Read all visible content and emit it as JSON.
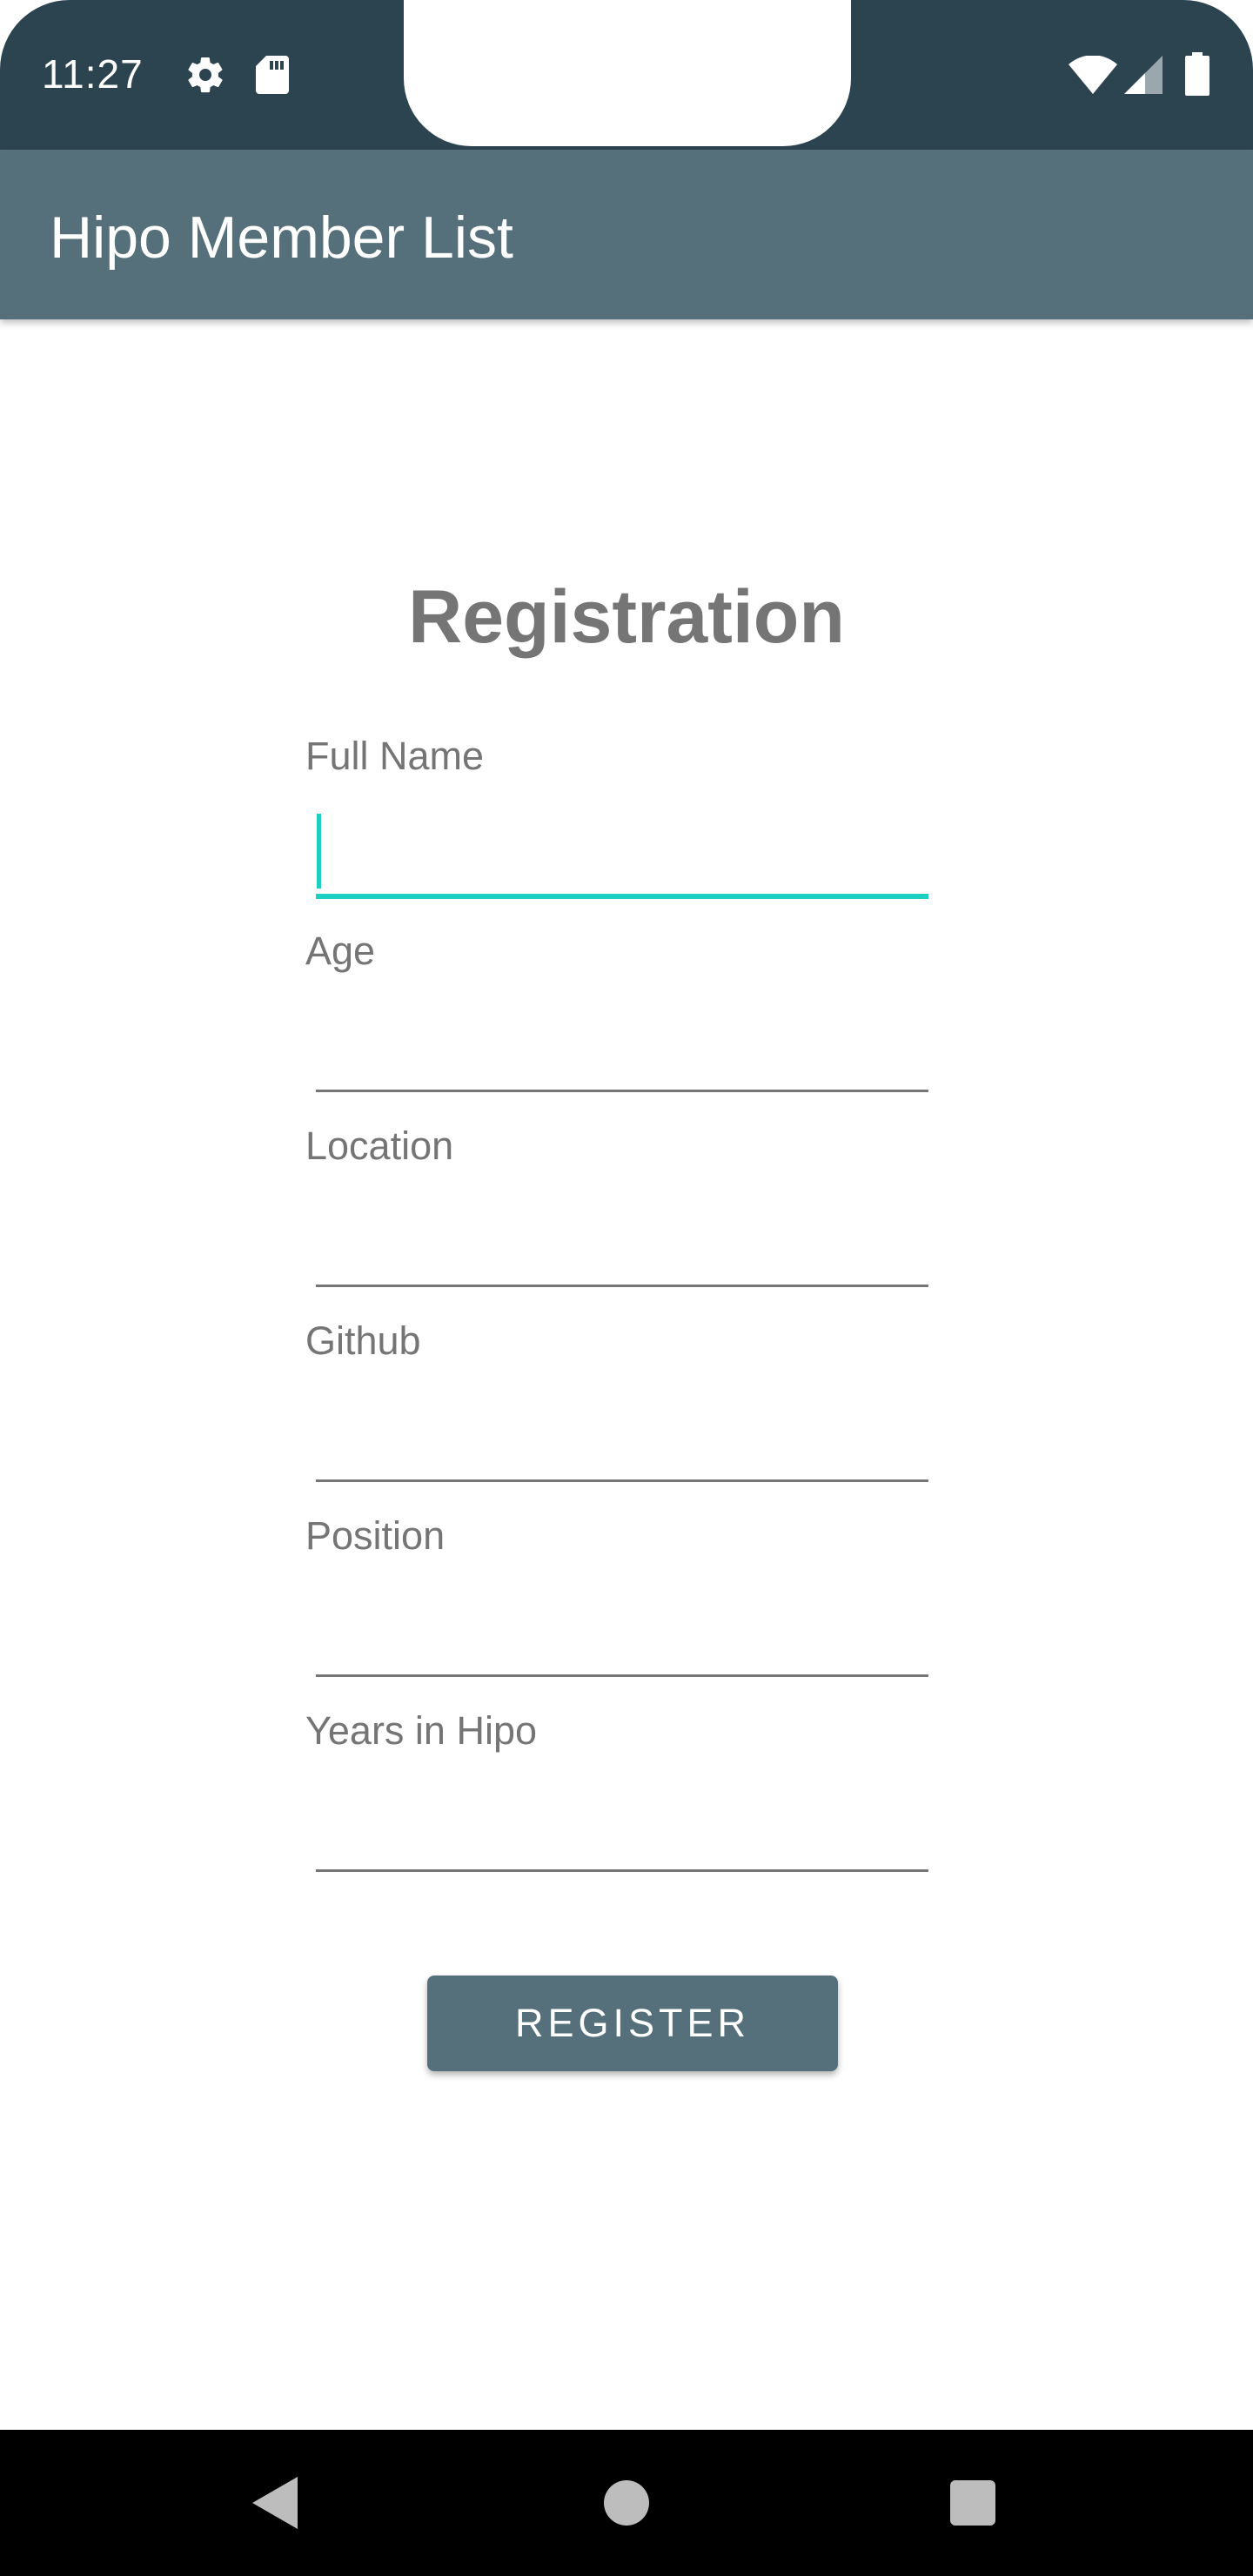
{
  "status_bar": {
    "time": "11:27",
    "icons": [
      "gear-icon",
      "sd-card-icon",
      "wifi-icon",
      "signal-icon",
      "battery-icon"
    ]
  },
  "app_bar": {
    "title": "Hipo Member List"
  },
  "form": {
    "title": "Registration",
    "fields": [
      {
        "label": "Full Name",
        "value": ""
      },
      {
        "label": "Age",
        "value": ""
      },
      {
        "label": "Location",
        "value": ""
      },
      {
        "label": "Github",
        "value": ""
      },
      {
        "label": "Position",
        "value": ""
      },
      {
        "label": "Years in Hipo",
        "value": ""
      }
    ],
    "register_label": "REGISTER"
  },
  "nav_bar": {
    "icons": [
      "back-icon",
      "home-icon",
      "recents-icon"
    ]
  },
  "colors": {
    "status_bar": "#2c4450",
    "app_bar": "#56707b",
    "accent": "#1dcfc2",
    "label_text": "#757575"
  }
}
